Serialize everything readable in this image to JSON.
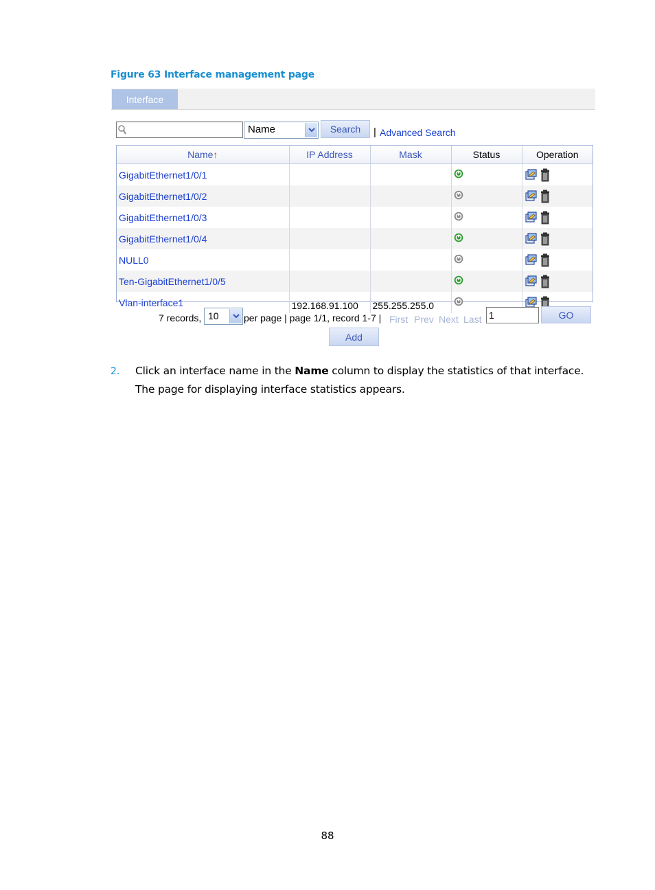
{
  "caption": "Figure 63 Interface management page",
  "tab": {
    "label": "Interface"
  },
  "search": {
    "input_value": "",
    "field_select": "Name",
    "search_label": "Search",
    "separator": "|",
    "advanced_label": "Advanced Search"
  },
  "table": {
    "headers": [
      "Name",
      "IP Address",
      "Mask",
      "Status",
      "Operation"
    ],
    "sort_indicator": "↑",
    "rows": [
      {
        "name": "GigabitEthernet1/0/1",
        "ip": "",
        "mask": "",
        "status": "up"
      },
      {
        "name": "GigabitEthernet1/0/2",
        "ip": "",
        "mask": "",
        "status": "down"
      },
      {
        "name": "GigabitEthernet1/0/3",
        "ip": "",
        "mask": "",
        "status": "down"
      },
      {
        "name": "GigabitEthernet1/0/4",
        "ip": "",
        "mask": "",
        "status": "up"
      },
      {
        "name": "NULL0",
        "ip": "",
        "mask": "",
        "status": "down"
      },
      {
        "name": "Ten-GigabitEthernet1/0/5",
        "ip": "",
        "mask": "",
        "status": "up"
      },
      {
        "name": "Vlan-interface1",
        "ip": "192.168.91.100",
        "mask": "255.255.255.0",
        "status": "down"
      }
    ],
    "operation_icons": [
      "edit-icon",
      "delete-icon"
    ]
  },
  "pager": {
    "records_text": "7 records,",
    "per_page_value": "10",
    "info_text": "per page | page 1/1, record 1-7 |",
    "first": "First",
    "prev": "Prev",
    "next": "Next",
    "last": "Last",
    "page_value": "1",
    "go_label": "GO"
  },
  "add_label": "Add",
  "step": {
    "number": "2.",
    "text_before": "Click an interface name in the ",
    "text_bold": "Name",
    "text_after": " column to display the statistics of that interface.",
    "sub": "The page for displaying interface statistics appears."
  },
  "page_number": "88",
  "colors": {
    "caption": "#1a8fd0",
    "link": "#1a3fcf",
    "status_up": "#2e9e2e",
    "status_down": "#8a8a8a",
    "tab": "#aec3e6"
  }
}
